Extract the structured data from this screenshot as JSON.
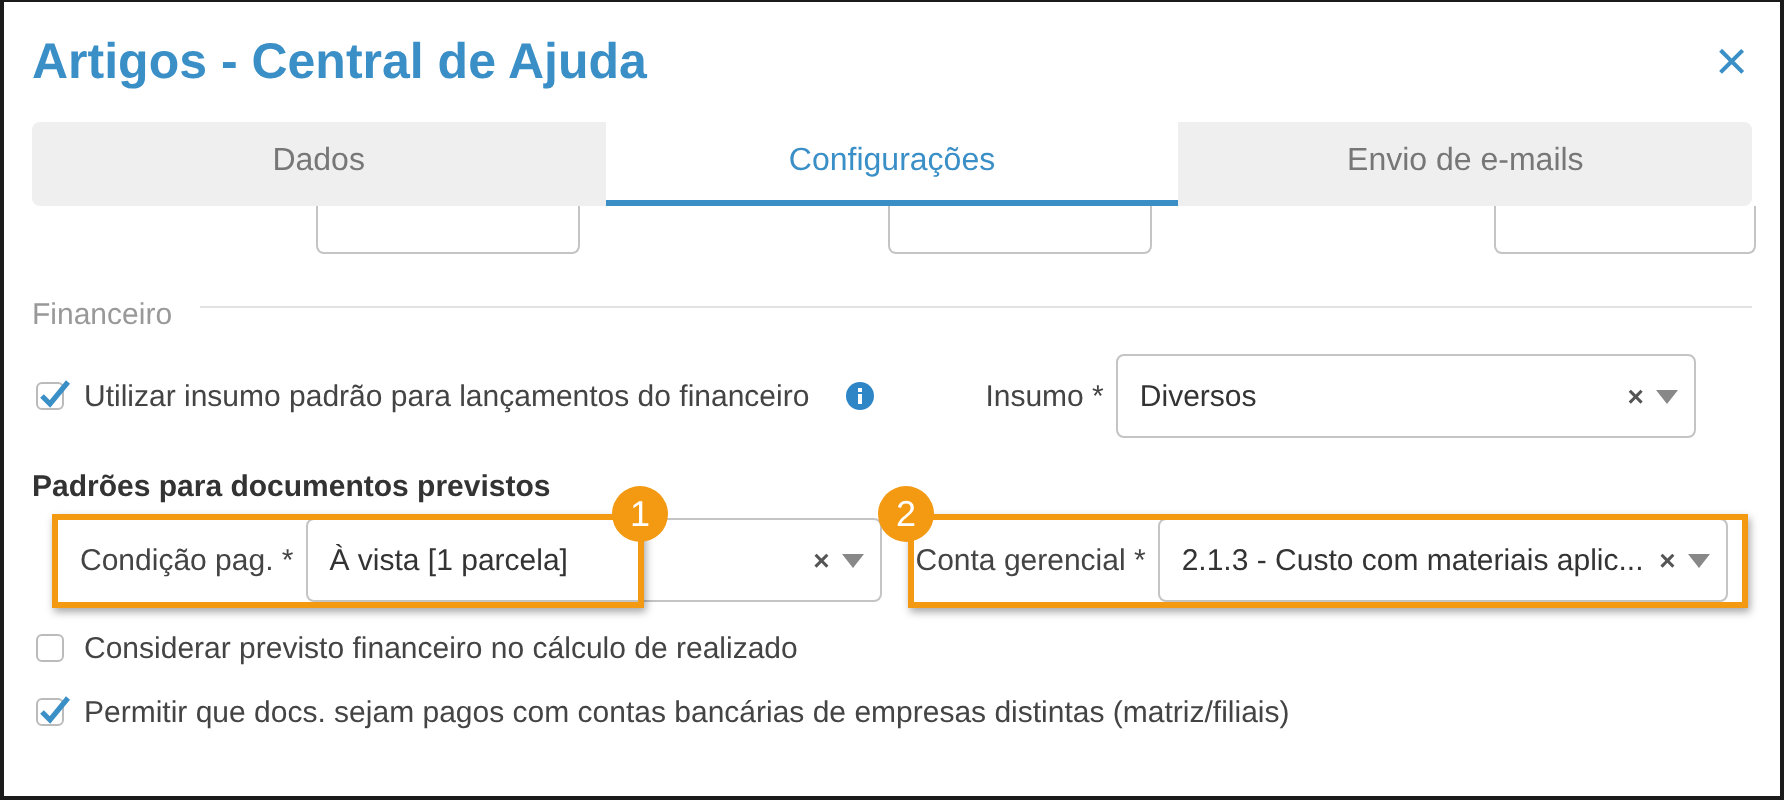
{
  "dialog": {
    "title": "Artigos - Central de Ajuda",
    "close": "×"
  },
  "tabs": [
    {
      "label": "Dados",
      "selected": false
    },
    {
      "label": "Configurações",
      "selected": true
    },
    {
      "label": "Envio de e-mails",
      "selected": false
    }
  ],
  "financeiro": {
    "heading": "Financeiro",
    "use_default_input": {
      "label": "Utilizar insumo padrão para lançamentos do financeiro",
      "checked": true
    },
    "insumo": {
      "label": "Insumo *",
      "value": "Diversos",
      "clear": "×"
    }
  },
  "documentos_previstos": {
    "heading": "Padrões para documentos previstos",
    "condicao_pag": {
      "label": "Condição pag. *",
      "value": "À vista [1 parcela]",
      "clear": "×"
    },
    "conta_gerencial": {
      "label": "Conta gerencial *",
      "value": "2.1.3 - Custo com materiais aplic...",
      "clear": "×"
    }
  },
  "options": [
    {
      "label": "Considerar previsto financeiro no cálculo de realizado",
      "checked": false
    },
    {
      "label": "Permitir que docs. sejam pagos com contas bancárias de empresas distintas (matriz/filiais)",
      "checked": true
    }
  ],
  "annotations": [
    {
      "number": "1"
    },
    {
      "number": "2"
    }
  ]
}
